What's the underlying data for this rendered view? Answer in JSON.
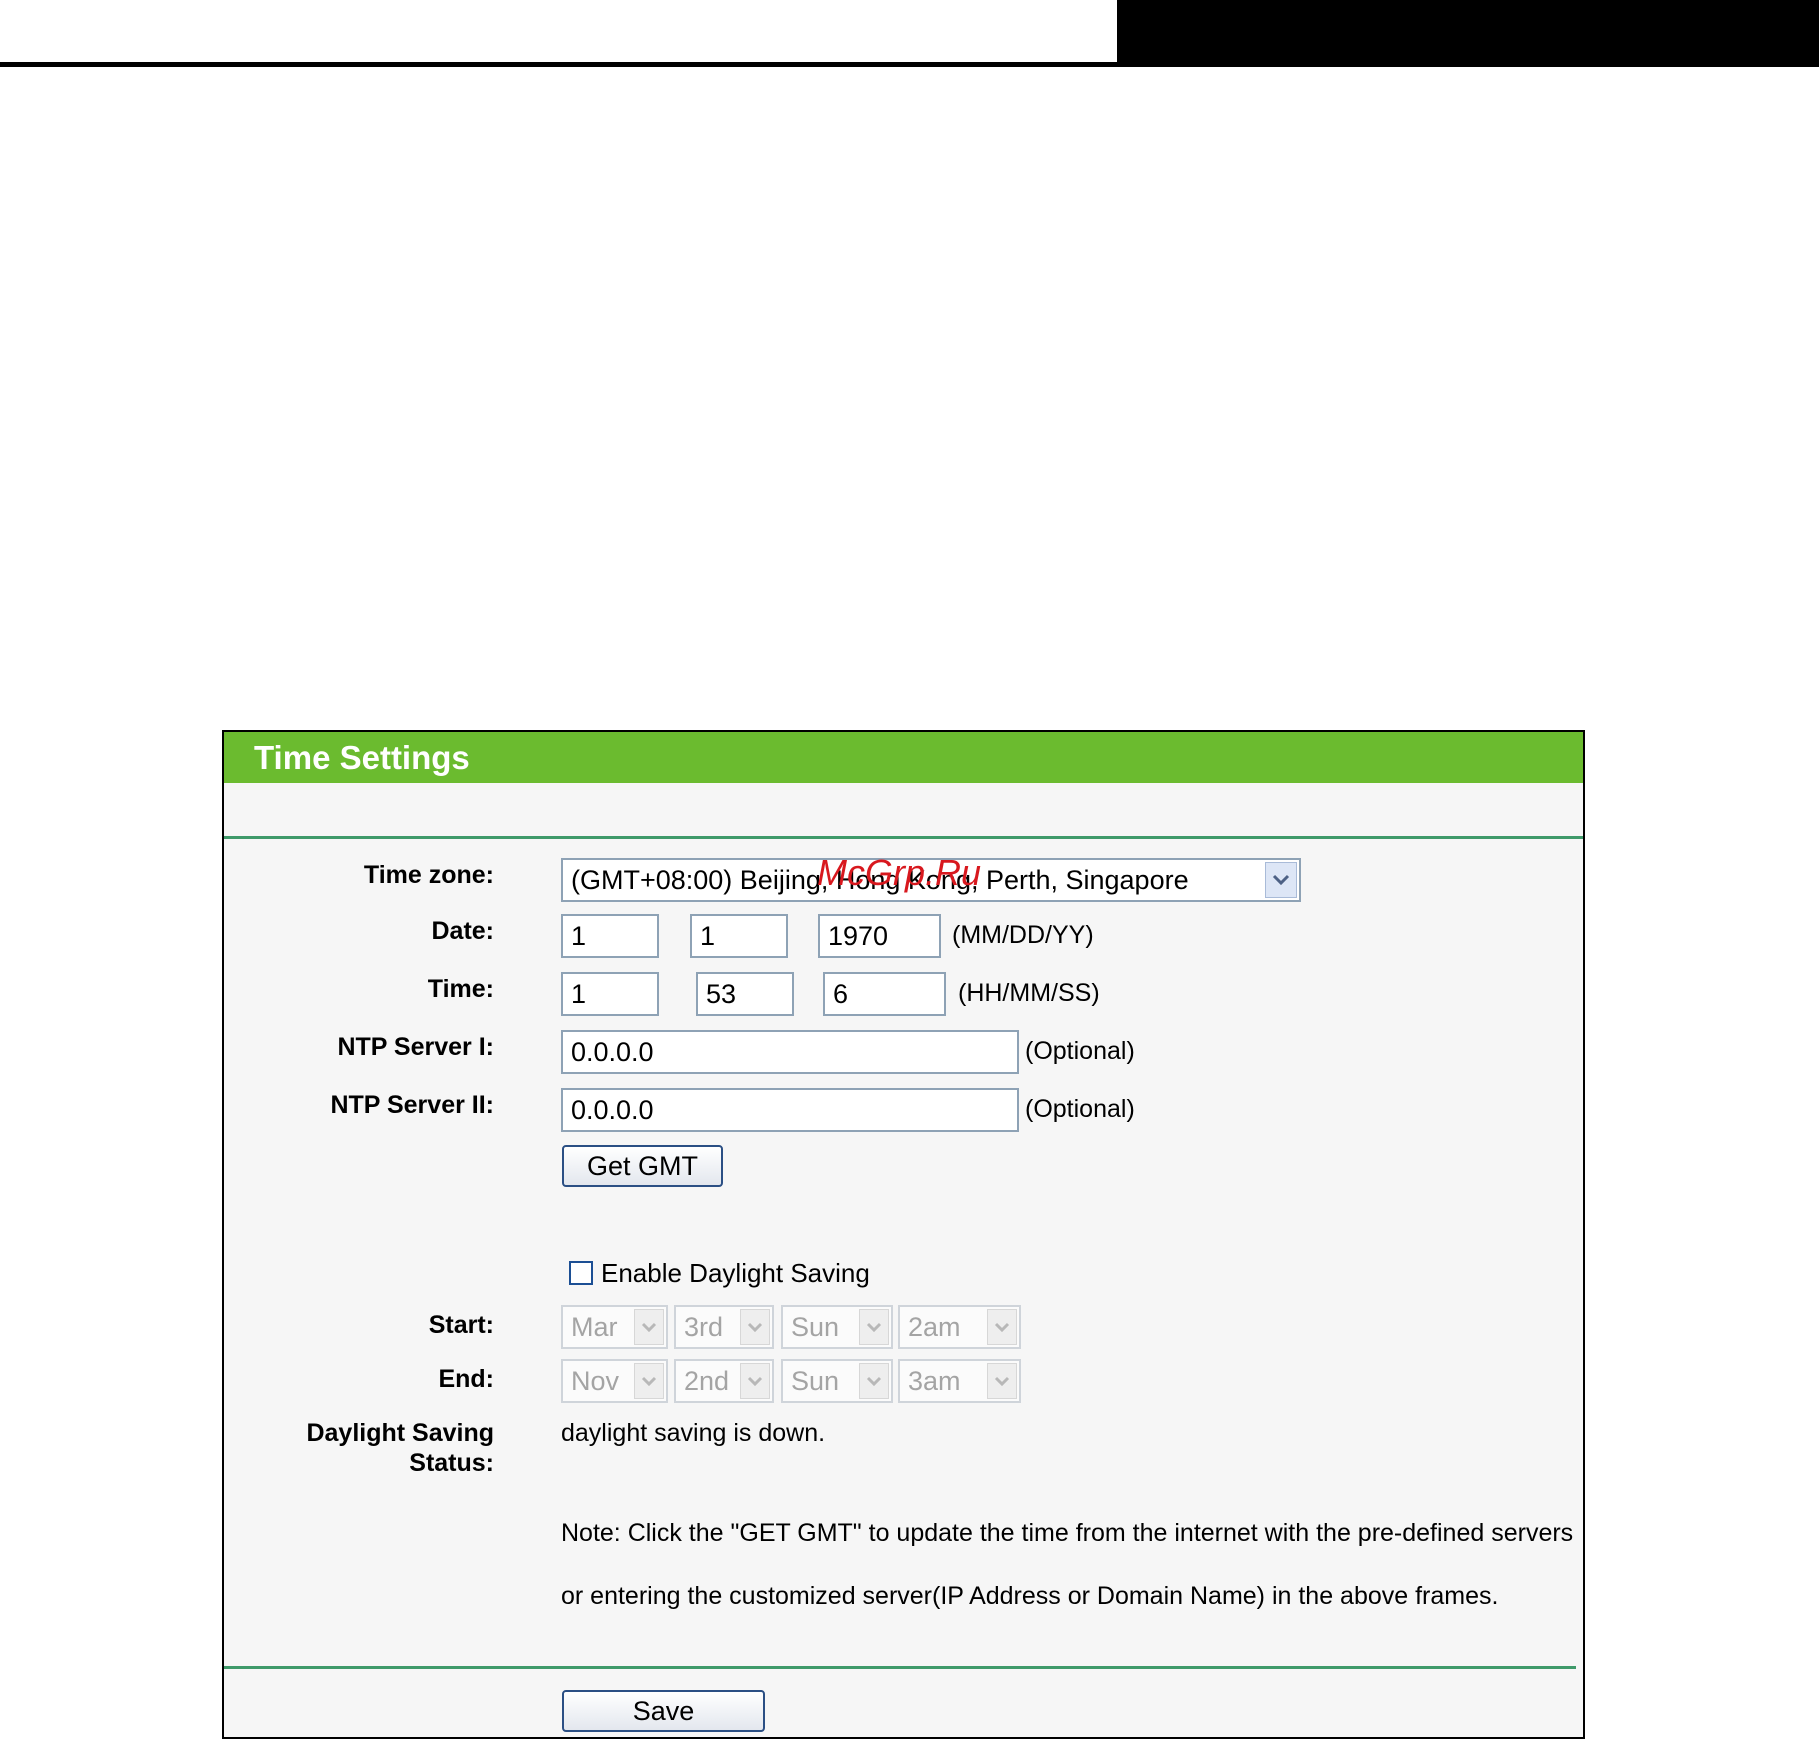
{
  "panel": {
    "title": "Time Settings"
  },
  "form": {
    "time_zone": {
      "label": "Time zone:",
      "value": "(GMT+08:00) Beijing, Hong Kong, Perth, Singapore"
    },
    "date": {
      "label": "Date:",
      "month": "1",
      "day": "1",
      "year": "1970",
      "hint": "(MM/DD/YY)"
    },
    "time": {
      "label": "Time:",
      "hour": "1",
      "minute": "53",
      "second": "6",
      "hint": "(HH/MM/SS)"
    },
    "ntp1": {
      "label": "NTP Server I:",
      "value": "0.0.0.0",
      "hint": "(Optional)"
    },
    "ntp2": {
      "label": "NTP Server II:",
      "value": "0.0.0.0",
      "hint": "(Optional)"
    },
    "get_gmt_label": "Get GMT",
    "daylight": {
      "enable_label": "Enable Daylight Saving",
      "enabled": false,
      "start_label": "Start:",
      "start": {
        "month": "Mar",
        "week": "3rd",
        "day": "Sun",
        "hour": "2am"
      },
      "end_label": "End:",
      "end": {
        "month": "Nov",
        "week": "2nd",
        "day": "Sun",
        "hour": "3am"
      },
      "status_label": "Daylight Saving Status:",
      "status_value": "daylight saving is down."
    },
    "note_line1": "Note: Click the \"GET GMT\" to update the time from the internet with the pre-defined servers",
    "note_line2": "or entering the customized server(IP Address or Domain Name) in the above frames.",
    "save_label": "Save"
  },
  "watermark": "McGrp.Ru",
  "colors": {
    "header_green": "#6bbb2f",
    "divider": "#3f9a6a",
    "watermark": "#d8181e"
  }
}
